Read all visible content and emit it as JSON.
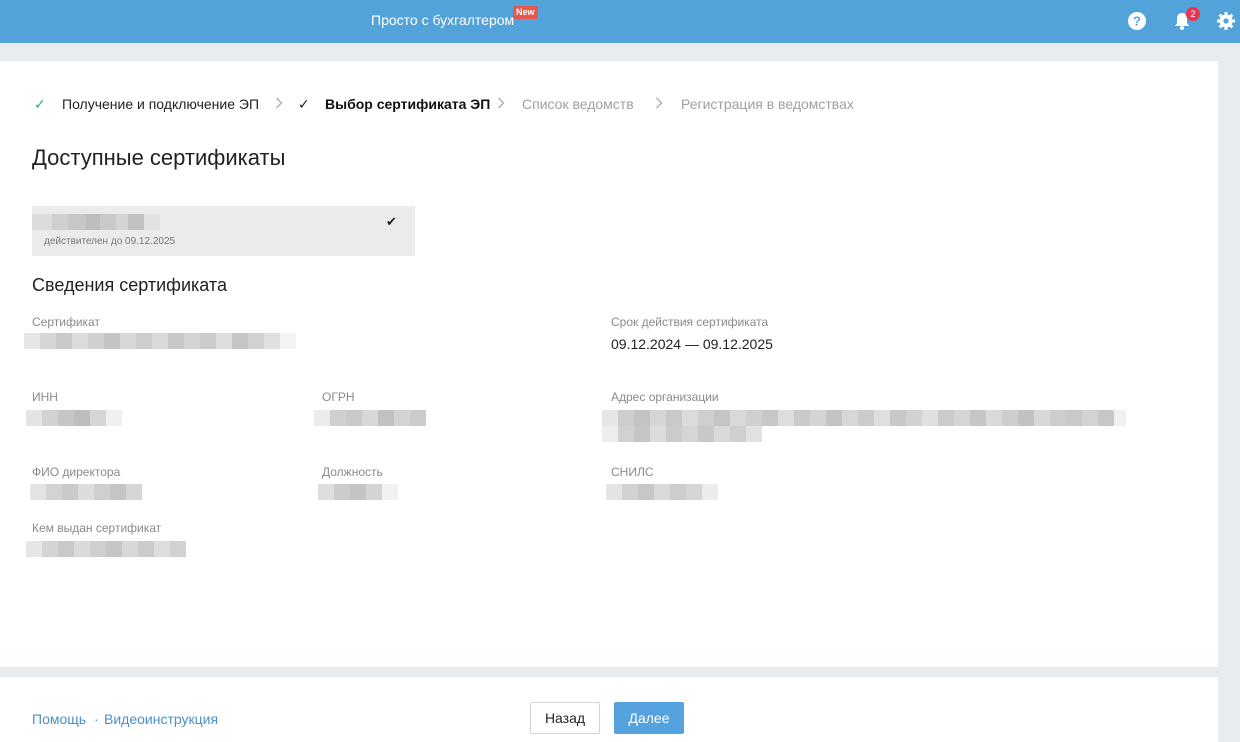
{
  "header": {
    "brand": "Просто с бухгалтером",
    "new_badge": "New",
    "notification_count": "2",
    "icons": [
      "help-icon",
      "bell-icon",
      "gear-icon"
    ],
    "colors": {
      "bar": "#53a3db",
      "badge": "#e4574c",
      "notif": "#e8344e"
    }
  },
  "steps": [
    {
      "label": "Получение и подключение ЭП",
      "state": "done"
    },
    {
      "label": "Выбор сертификата ЭП",
      "state": "current"
    },
    {
      "label": "Список ведомств",
      "state": "pending"
    },
    {
      "label": "Регистрация в ведомствах",
      "state": "pending"
    }
  ],
  "page": {
    "title": "Доступные сертификаты",
    "certificate_card": {
      "validity": "действителен до 09.12.2025",
      "selected": true
    },
    "details_title": "Сведения сертификата",
    "fields": {
      "certificate": {
        "label": "Сертификат"
      },
      "validity_period": {
        "label": "Срок действия сертификата",
        "value": "09.12.2024 — 09.12.2025"
      },
      "inn": {
        "label": "ИНН"
      },
      "ogrn": {
        "label": "ОГРН"
      },
      "address": {
        "label": "Адрес организации"
      },
      "director": {
        "label": "ФИО директора"
      },
      "position": {
        "label": "Должность"
      },
      "snils": {
        "label": "СНИЛС"
      },
      "issuer": {
        "label": "Кем выдан сертификат"
      }
    }
  },
  "footer": {
    "help_link": "Помощь",
    "separator": "·",
    "video_link": "Видеоинструкция",
    "back_button": "Назад",
    "next_button": "Далее"
  }
}
